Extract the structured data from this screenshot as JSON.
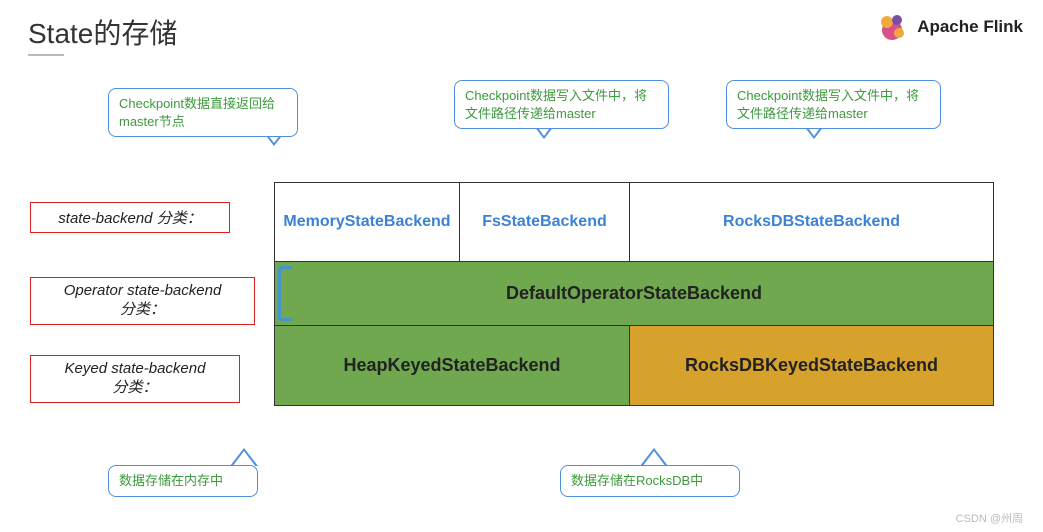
{
  "header": {
    "title": "State的存储",
    "brand": "Apache Flink"
  },
  "callouts": {
    "top_left": "Checkpoint数据直接返回给master节点",
    "top_mid": "Checkpoint数据写入文件中，将文件路径传递给master",
    "top_right": "Checkpoint数据写入文件中，将文件路径传递给master",
    "bottom_left": "数据存储在内存中",
    "bottom_right": "数据存储在RocksDB中"
  },
  "labels": {
    "sb_category": "state-backend 分类：",
    "op_category_l1": "Operator state-backend",
    "op_category_l2": "分类：",
    "keyed_category_l1": "Keyed state-backend",
    "keyed_category_l2": "分类："
  },
  "row1": {
    "memory": "MemoryStateBackend",
    "fs": "FsStateBackend",
    "rocks": "RocksDBStateBackend"
  },
  "row2": {
    "default_op": "DefaultOperatorStateBackend"
  },
  "row3": {
    "heap": "HeapKeyedStateBackend",
    "rocks": "RocksDBKeyedStateBackend"
  },
  "footer": {
    "credit": "CSDN @州周"
  }
}
